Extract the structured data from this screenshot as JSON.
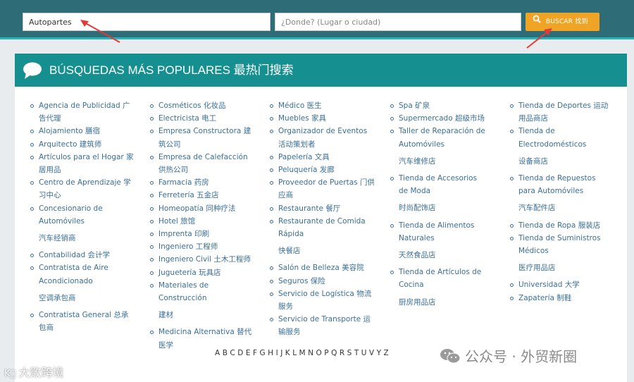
{
  "search": {
    "what_value": "Autopartes",
    "where_placeholder": "¿Donde? (Lugar o ciudad)",
    "button_label": "BUSCAR 找到"
  },
  "panel": {
    "title": "BÚSQUEDAS MÁS POPULARES 最热门搜索"
  },
  "columns": [
    [
      {
        "t": "Agencia de Publicidad 广告代理",
        "b": true
      },
      {
        "t": "Alojamiento 膳宿",
        "b": true
      },
      {
        "t": "Arquitecto 建筑师",
        "b": true
      },
      {
        "t": "Artículos para el Hogar 家居用品",
        "b": true
      },
      {
        "t": "Centro de Aprendizaje 学习中心",
        "b": true
      },
      {
        "t": "Concesionario de Automóviles",
        "b": true
      },
      {
        "t": "汽车经销商",
        "b": false
      },
      {
        "t": "Contabilidad 会计学",
        "b": true
      },
      {
        "t": "Contratista de Aire Acondicionado",
        "b": true
      },
      {
        "t": "空调承包商",
        "b": false
      },
      {
        "t": "Contratista General 总承包商",
        "b": true
      }
    ],
    [
      {
        "t": "Cosméticos 化妆品",
        "b": true
      },
      {
        "t": "Electricista 电工",
        "b": true
      },
      {
        "t": "Empresa Constructora 建筑公司",
        "b": true
      },
      {
        "t": "Empresa de Calefacción 供热公司",
        "b": true
      },
      {
        "t": "Farmacia 药房",
        "b": true
      },
      {
        "t": "Ferretería 五金店",
        "b": true
      },
      {
        "t": "Homeopatía 同种疗法",
        "b": true
      },
      {
        "t": "Hotel 旅馆",
        "b": true
      },
      {
        "t": "Imprenta 印刷",
        "b": true
      },
      {
        "t": "Ingeniero 工程师",
        "b": true
      },
      {
        "t": "Ingeniero Civil 土木工程师",
        "b": true
      },
      {
        "t": "Juguetería 玩具店",
        "b": true
      },
      {
        "t": "Materiales de Construcción",
        "b": true
      },
      {
        "t": "建材",
        "b": false
      },
      {
        "t": "Medicina Alternativa 替代医学",
        "b": true
      }
    ],
    [
      {
        "t": "Médico 医生",
        "b": true
      },
      {
        "t": "Muebles 家具",
        "b": true
      },
      {
        "t": "Organizador de Eventos 活动策划者",
        "b": true
      },
      {
        "t": "Papelería 文具",
        "b": true
      },
      {
        "t": "Peluquería 发廊",
        "b": true
      },
      {
        "t": "Proveedor de Puertas 门供应商",
        "b": true
      },
      {
        "t": "Restaurante 餐厅",
        "b": true
      },
      {
        "t": "Restaurante de Comida Rápida",
        "b": true
      },
      {
        "t": "快餐店",
        "b": false
      },
      {
        "t": "Salón de Belleza 美容院",
        "b": true
      },
      {
        "t": "Seguros 保险",
        "b": true
      },
      {
        "t": "Servicio de Logística 物流服务",
        "b": true
      },
      {
        "t": "Servicio de Transporte 运输服务",
        "b": true
      }
    ],
    [
      {
        "t": "Spa 矿泉",
        "b": true
      },
      {
        "t": "Supermercado 超级市场",
        "b": true
      },
      {
        "t": "Taller de Reparación de Automóviles",
        "b": true
      },
      {
        "t": "汽车维修店",
        "b": false
      },
      {
        "t": "Tienda de Accesorios de Moda",
        "b": true
      },
      {
        "t": "时尚配饰店",
        "b": false
      },
      {
        "t": "Tienda de Alimentos Naturales",
        "b": true
      },
      {
        "t": "天然食品店",
        "b": false
      },
      {
        "t": "Tienda de Artículos de Cocina",
        "b": true
      },
      {
        "t": "厨房用品店",
        "b": false
      }
    ],
    [
      {
        "t": "Tienda de Deportes 运动用品商店",
        "b": true
      },
      {
        "t": "Tienda de Electrodomésticos",
        "b": true
      },
      {
        "t": "设备商店",
        "b": false
      },
      {
        "t": "Tienda de Repuestos para Automóviles",
        "b": true
      },
      {
        "t": "汽车配件店",
        "b": false
      },
      {
        "t": "Tienda de Ropa 服装店",
        "b": true
      },
      {
        "t": "Tienda de Suministros Médicos",
        "b": true
      },
      {
        "t": "医疗用品店",
        "b": false
      },
      {
        "t": "Universidad 大学",
        "b": true
      },
      {
        "t": "Zapatería 制鞋",
        "b": true
      }
    ]
  ],
  "alphabet": [
    "A",
    "B",
    "C",
    "D",
    "E",
    "F",
    "G",
    "H",
    "I",
    "J",
    "K",
    "L",
    "M",
    "N",
    "O",
    "P",
    "Q",
    "R",
    "S",
    "T",
    "U",
    "V",
    "Y",
    "Z"
  ],
  "watermark_right": "公众号 · 外贸新圈",
  "watermark_left": "大败跨境",
  "colors": {
    "topbar": "#2e6c77",
    "header": "#158f90",
    "button": "#f0a426",
    "link": "#3b6f99",
    "arrow": "#e53935"
  }
}
